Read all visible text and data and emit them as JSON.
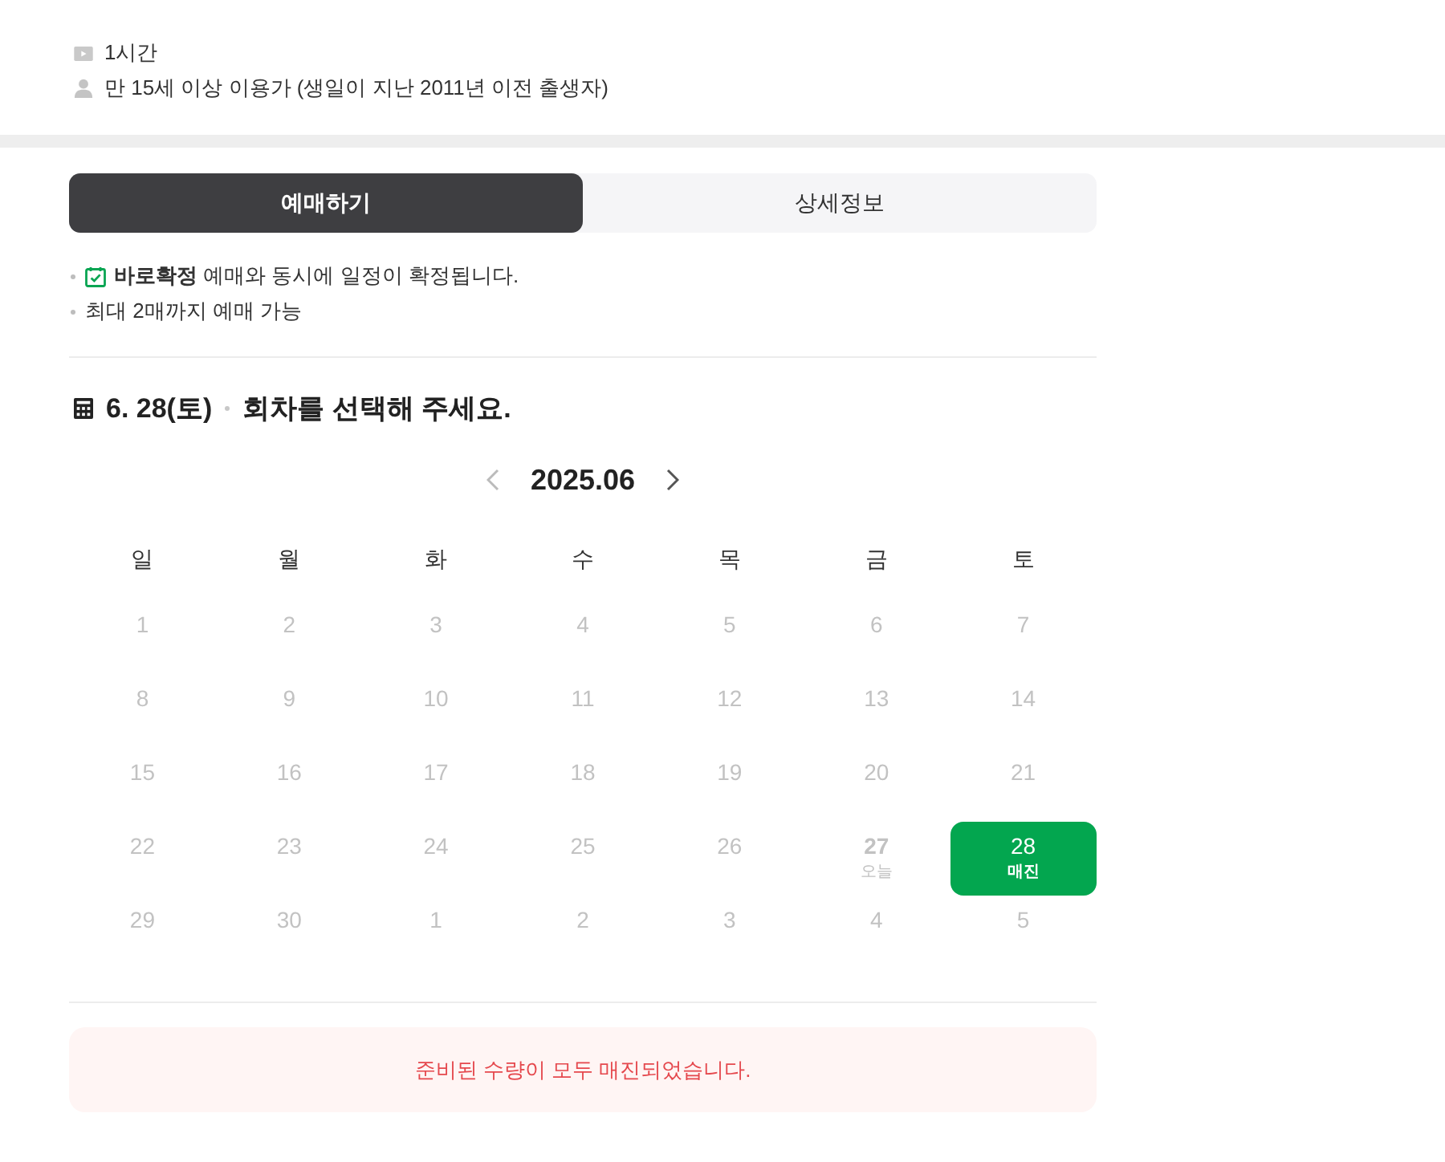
{
  "info": [
    {
      "kind": "duration",
      "text": "1시간"
    },
    {
      "kind": "age",
      "text": "만 15세 이상 이용가 (생일이 지난 2011년 이전 출생자)"
    }
  ],
  "tabs": [
    {
      "label": "예매하기",
      "selected": true
    },
    {
      "label": "상세정보",
      "selected": false
    }
  ],
  "notes": [
    {
      "kind": "confirm",
      "text": "**바로확정** 예매와 동시에 일정이 확정됩니다."
    },
    {
      "kind": "plain",
      "text": "최대 2매까지 예매 가능"
    }
  ],
  "heading": {
    "date": "6. 28(토)",
    "prompt": "회차를 선택해 주세요."
  },
  "calendar": {
    "month": "2025.06",
    "prev_disabled": true,
    "next_disabled": false,
    "weekdays": [
      "일",
      "월",
      "화",
      "수",
      "목",
      "금",
      "토"
    ],
    "days": [
      {
        "day": "1",
        "disabled": true,
        "today": false,
        "selected": false
      },
      {
        "day": "2",
        "disabled": true,
        "today": false,
        "selected": false
      },
      {
        "day": "3",
        "disabled": true,
        "today": false,
        "selected": false
      },
      {
        "day": "4",
        "disabled": true,
        "today": false,
        "selected": false
      },
      {
        "day": "5",
        "disabled": true,
        "today": false,
        "selected": false
      },
      {
        "day": "6",
        "disabled": true,
        "today": false,
        "selected": false
      },
      {
        "day": "7",
        "disabled": true,
        "today": false,
        "selected": false
      },
      {
        "day": "8",
        "disabled": true,
        "today": false,
        "selected": false
      },
      {
        "day": "9",
        "disabled": true,
        "today": false,
        "selected": false
      },
      {
        "day": "10",
        "disabled": true,
        "today": false,
        "selected": false
      },
      {
        "day": "11",
        "disabled": true,
        "today": false,
        "selected": false
      },
      {
        "day": "12",
        "disabled": true,
        "today": false,
        "selected": false
      },
      {
        "day": "13",
        "disabled": true,
        "today": false,
        "selected": false
      },
      {
        "day": "14",
        "disabled": true,
        "today": false,
        "selected": false
      },
      {
        "day": "15",
        "disabled": true,
        "today": false,
        "selected": false
      },
      {
        "day": "16",
        "disabled": true,
        "today": false,
        "selected": false
      },
      {
        "day": "17",
        "disabled": true,
        "today": false,
        "selected": false
      },
      {
        "day": "18",
        "disabled": true,
        "today": false,
        "selected": false
      },
      {
        "day": "19",
        "disabled": true,
        "today": false,
        "selected": false
      },
      {
        "day": "20",
        "disabled": true,
        "today": false,
        "selected": false
      },
      {
        "day": "21",
        "disabled": true,
        "today": false,
        "selected": false
      },
      {
        "day": "22",
        "disabled": true,
        "today": false,
        "selected": false
      },
      {
        "day": "23",
        "disabled": true,
        "today": false,
        "selected": false
      },
      {
        "day": "24",
        "disabled": true,
        "today": false,
        "selected": false
      },
      {
        "day": "25",
        "disabled": true,
        "today": false,
        "selected": false
      },
      {
        "day": "26",
        "disabled": true,
        "today": false,
        "selected": false
      },
      {
        "day": "27",
        "sublabel": "오늘",
        "disabled": true,
        "today": true,
        "selected": false
      },
      {
        "day": "28",
        "sublabel": "매진",
        "disabled": false,
        "today": false,
        "selected": true
      },
      {
        "day": "29",
        "disabled": true,
        "today": false,
        "selected": false
      },
      {
        "day": "30",
        "disabled": true,
        "today": false,
        "selected": false
      },
      {
        "day": "1",
        "disabled": true,
        "today": false,
        "selected": false
      },
      {
        "day": "2",
        "disabled": true,
        "today": false,
        "selected": false
      },
      {
        "day": "3",
        "disabled": true,
        "today": false,
        "selected": false
      },
      {
        "day": "4",
        "disabled": true,
        "today": false,
        "selected": false
      },
      {
        "day": "5",
        "disabled": true,
        "today": false,
        "selected": false
      }
    ]
  },
  "alert": {
    "text": "준비된 수량이 모두 매진되었습니다."
  }
}
